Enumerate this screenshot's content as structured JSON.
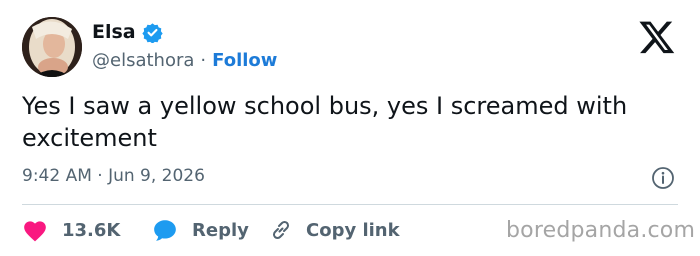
{
  "author": {
    "display_name": "Elsa",
    "handle": "@elsathora",
    "separator": "·",
    "follow_label": "Follow",
    "verified": true
  },
  "tweet": {
    "text": "Yes I saw a yellow school bus, yes I screamed with excitement",
    "timestamp": "9:42 AM · Jun 9, 2026"
  },
  "actions": {
    "like_count": "13.6K",
    "reply_label": "Reply",
    "copy_link_label": "Copy link"
  },
  "watermark": "boredpanda.com",
  "icons": {
    "brand": "x-logo-icon",
    "verified": "verified-badge-icon",
    "info": "info-icon",
    "like": "heart-icon",
    "reply": "speech-bubble-icon",
    "copy": "link-icon"
  },
  "colors": {
    "text": "#0f1419",
    "secondary": "#536471",
    "accent": "#1d7bd8",
    "verified": "#1d9bf0",
    "like": "#f91880",
    "divider": "#cfd9de",
    "watermark": "#a5a5a5"
  }
}
